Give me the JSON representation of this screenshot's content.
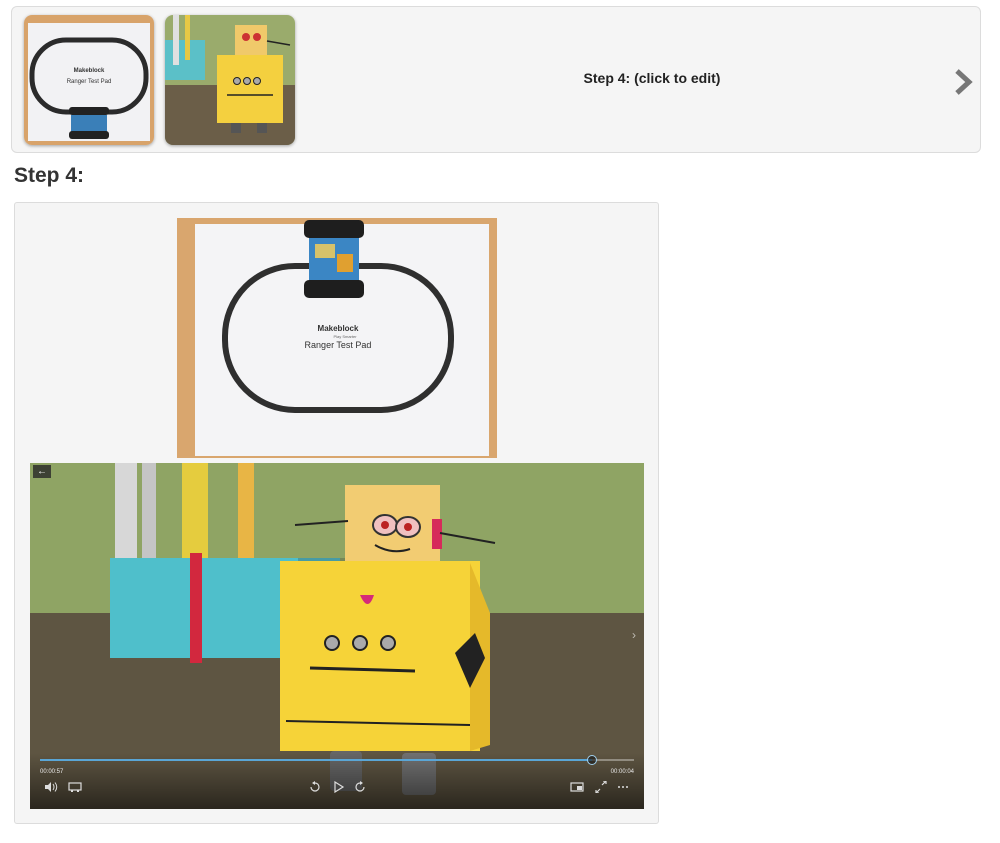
{
  "stepbar": {
    "title": "Step 4: (click to edit)",
    "thumbnails": [
      {
        "name": "Ranger test pad with robot",
        "pad_brand": "Makeblock",
        "pad_label": "Ranger Test Pad"
      },
      {
        "name": "Yellow paper robot"
      }
    ],
    "next_icon": "chevron-right-icon"
  },
  "step": {
    "heading": "Step 4:"
  },
  "photo": {
    "pad_brand": "Makeblock",
    "pad_tagline": "Play Smarter",
    "pad_label": "Ranger Test Pad"
  },
  "video": {
    "elapsed": "00:00:57",
    "remaining": "00:00:04",
    "progress": 0.93,
    "icons": {
      "back": "back-arrow-icon",
      "volume": "volume-icon",
      "captions": "captions-icon",
      "rewind": "rewind-icon",
      "play": "play-icon",
      "forward": "forward-icon",
      "pip": "picture-in-picture-icon",
      "fullscreen": "fullscreen-icon",
      "more": "more-icon"
    }
  },
  "colors": {
    "panel_bg": "#f5f5f5",
    "panel_border": "#dcdcdc",
    "seek_accent": "#5aa6d6",
    "robot_yellow": "#f4d03f",
    "pad_track": "#2b2b2b"
  }
}
